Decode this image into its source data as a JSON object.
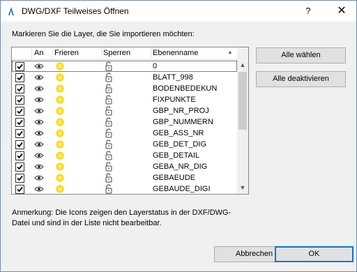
{
  "window": {
    "title": "DWG/DXF Teilweises Öffnen",
    "help": "?",
    "close": "✕"
  },
  "instruction": "Markieren Sie die Layer, die Sie importieren möchten:",
  "columns": {
    "an": "An",
    "frieren": "Frieren",
    "sperren": "Sperren",
    "ebenenname": "Ebenenname"
  },
  "layers": [
    {
      "name": "0",
      "checked": true
    },
    {
      "name": "BLATT_998",
      "checked": true
    },
    {
      "name": "BODENBEDEKUN",
      "checked": true
    },
    {
      "name": "FIXPUNKTE",
      "checked": true
    },
    {
      "name": "GBP_NR_PROJ",
      "checked": true
    },
    {
      "name": "GBP_NUMMERN",
      "checked": true
    },
    {
      "name": "GEB_ASS_NR",
      "checked": true
    },
    {
      "name": "GEB_DET_DIG",
      "checked": true
    },
    {
      "name": "GEB_DETAIL",
      "checked": true
    },
    {
      "name": "GEBA_NR_DIG",
      "checked": true
    },
    {
      "name": "GEBAEUDE",
      "checked": true
    },
    {
      "name": "GEBAUDE_DIGI",
      "checked": true
    }
  ],
  "icons": {
    "visible": "eye-icon",
    "frozen": "sun-icon",
    "lock": "lock-icon"
  },
  "buttons": {
    "select_all": "Alle wählen",
    "deselect_all": "Alle deaktivieren",
    "cancel": "Abbrechen",
    "ok": "OK"
  },
  "note": "Anmerkung: Die Icons zeigen den Layerstatus in der DXF/DWG-Datei und sind in der Liste nicht bearbeitbar.",
  "colors": {
    "sun": "#ffd400",
    "accent": "#0078d7"
  }
}
